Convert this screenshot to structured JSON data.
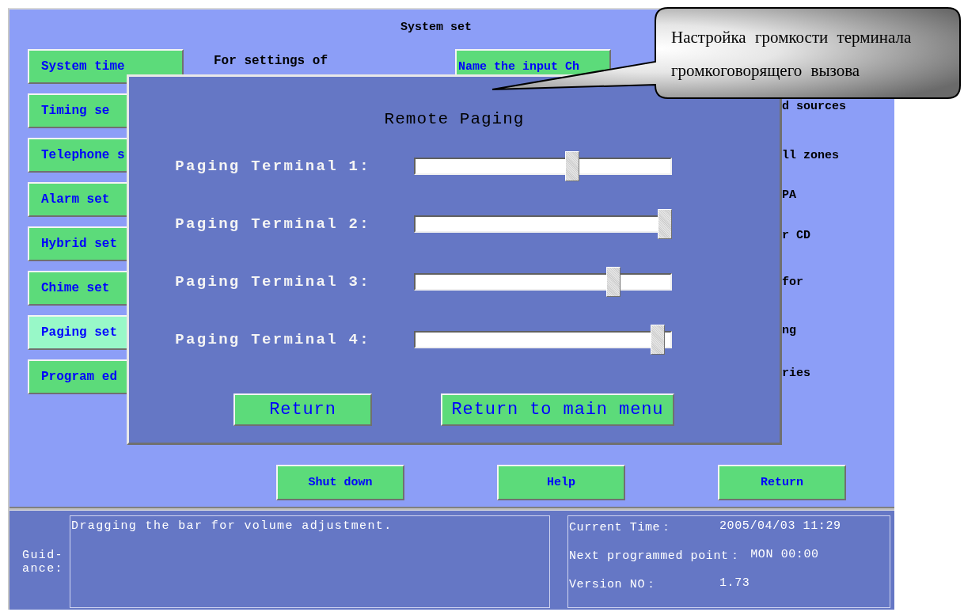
{
  "screen": {
    "title": "System set",
    "menu": [
      {
        "label": "System time",
        "selected": false
      },
      {
        "label": "Timing se",
        "selected": false
      },
      {
        "label": "Telephone s",
        "selected": false
      },
      {
        "label": "Alarm set",
        "selected": false
      },
      {
        "label": "Hybrid set",
        "selected": false
      },
      {
        "label": "Chime set",
        "selected": false
      },
      {
        "label": "Paging set",
        "selected": true
      },
      {
        "label": "Program ed",
        "selected": false
      }
    ],
    "info_text": "For settings of",
    "name_button": "Name the input Ch",
    "right_fragments": [
      "d sources",
      "ll zones",
      "PA",
      "r CD",
      "for",
      "ng",
      "ries"
    ],
    "buttons": [
      "Shut down",
      "Help",
      "Return"
    ]
  },
  "dialog": {
    "title": "Remote Paging",
    "sliders": [
      {
        "label": "Paging Terminal 1:",
        "level": 0.62
      },
      {
        "label": "Paging Terminal 2:",
        "level": 1
      },
      {
        "label": "Paging Terminal 3:",
        "level": 0.79
      },
      {
        "label": "Paging Terminal 4:",
        "level": 0.97
      }
    ],
    "buttons": [
      "Return",
      "Return to main menu"
    ]
  },
  "status": {
    "label_lines": [
      "Guid-",
      "ance:"
    ],
    "guidance": "Dragging the bar for volume adjustment.",
    "info": [
      {
        "label": "Current Time：",
        "value": "2005/04/03 11:29"
      },
      {
        "label": "Next programmed point：",
        "value": "MON 00:00"
      },
      {
        "label": "Version NO：",
        "value": "1.73"
      }
    ]
  },
  "callout": {
    "text": "Настройка громкости терминала громкоговорящего вызова"
  }
}
